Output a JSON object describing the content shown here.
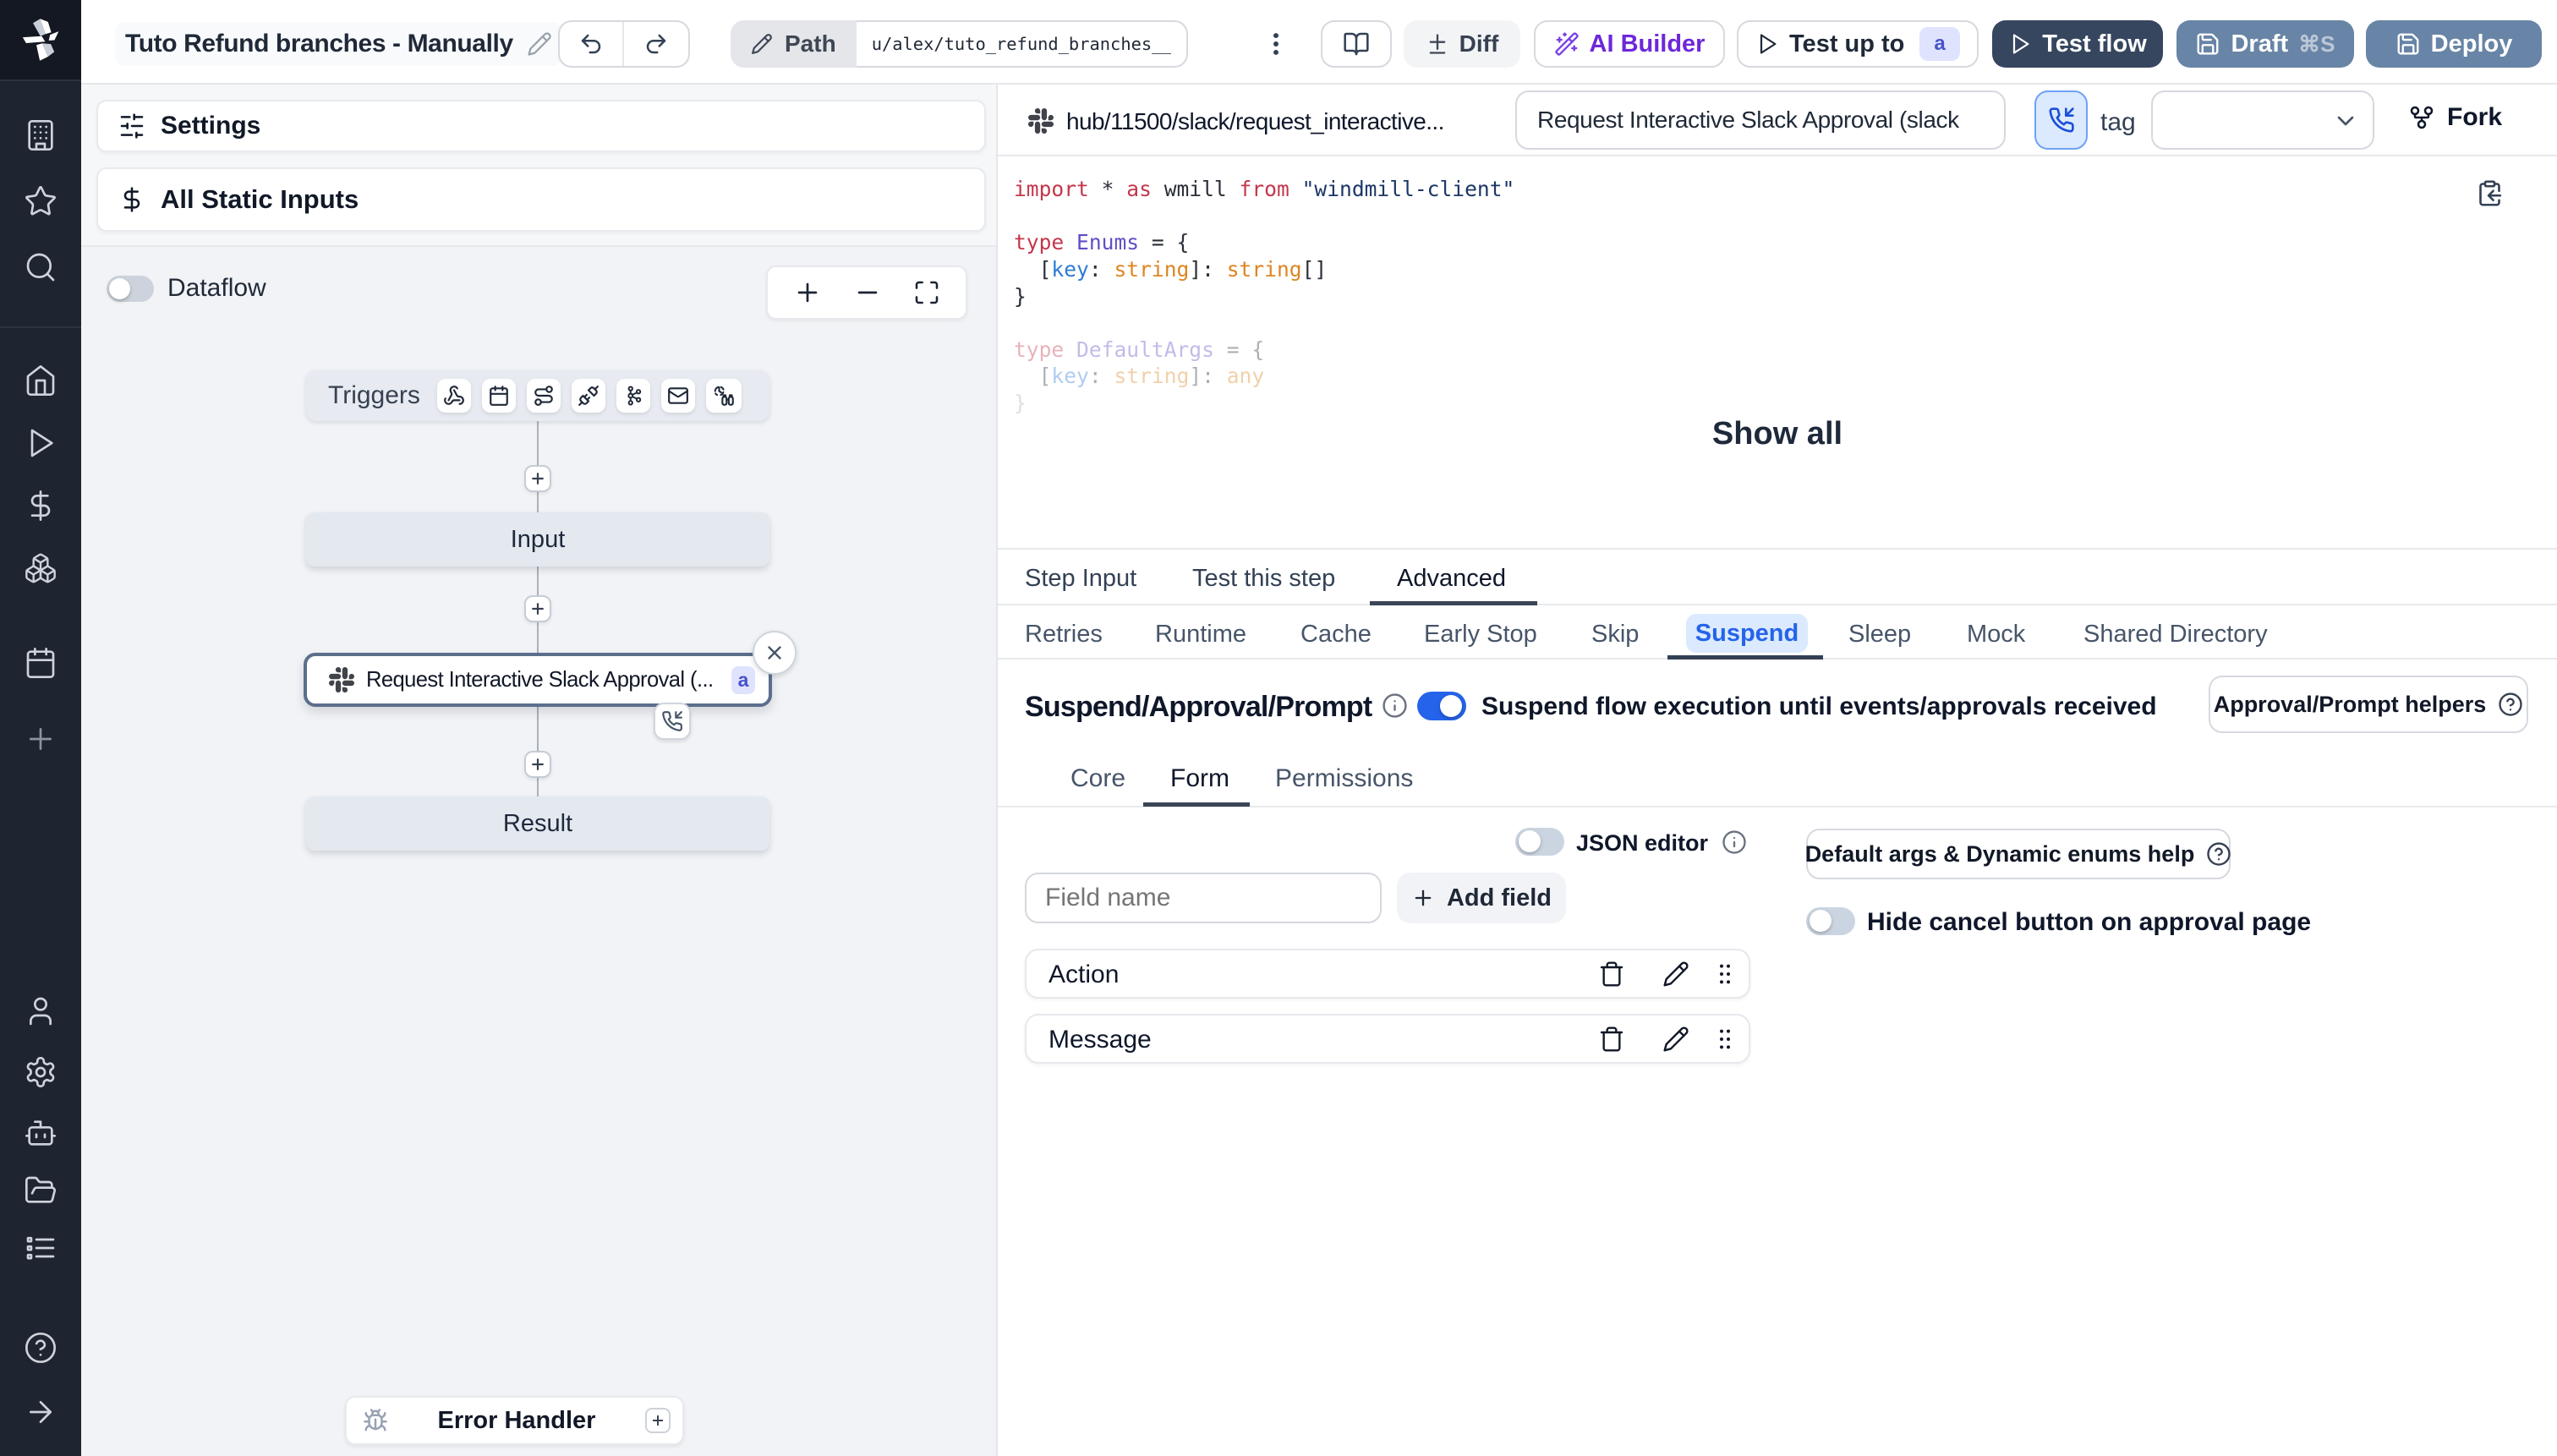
{
  "topbar": {
    "title": "Tuto Refund branches - Manually",
    "path_label": "Path",
    "path_value": "u/alex/tuto_refund_branches__",
    "diff": "Diff",
    "ai_builder": "AI Builder",
    "test_up_to": "Test up to",
    "test_up_to_badge": "a",
    "test_flow": "Test flow",
    "draft": "Draft",
    "draft_shortcut": "⌘S",
    "deploy": "Deploy"
  },
  "left": {
    "settings": "Settings",
    "static_inputs": "All Static Inputs",
    "dataflow": "Dataflow",
    "flow": {
      "triggers": "Triggers",
      "input": "Input",
      "step": "Request Interactive Slack Approval (...",
      "step_badge": "a",
      "result": "Result",
      "error_handler": "Error Handler"
    }
  },
  "step": {
    "hub_path": "hub/11500/slack/request_interactive...",
    "name": "Request Interactive Slack Approval (slack",
    "tag_label": "tag",
    "fork": "Fork",
    "show_all": "Show all",
    "code": {
      "l1": {
        "k1": "import",
        "p1": " * ",
        "k2": "as",
        "p2": " wmill ",
        "k3": "from",
        "p3": " ",
        "s1": "\"windmill-client\""
      },
      "l3": {
        "k1": "type",
        "p1": " ",
        "t1": "Enums",
        "p2": " = {"
      },
      "l4": {
        "p1": "  [",
        "v1": "key",
        "p2": ": ",
        "o1": "string",
        "p3": "]: ",
        "o2": "string",
        "p4": "[]"
      },
      "l5": {
        "p1": "}"
      },
      "l7": {
        "k1": "type",
        "p1": " ",
        "t1": "DefaultArgs",
        "p2": " = {"
      },
      "l8": {
        "p1": "  [",
        "v1": "key",
        "p2": ": ",
        "o1": "string",
        "p3": "]: ",
        "o2": "any"
      },
      "l9": {
        "p1": "}"
      }
    },
    "tabs": {
      "t1": "Step Input",
      "t2": "Test this step",
      "t3": "Advanced"
    },
    "subtabs": {
      "s1": "Retries",
      "s2": "Runtime",
      "s3": "Cache",
      "s4": "Early Stop",
      "s5": "Skip",
      "s6": "Suspend",
      "s7": "Sleep",
      "s8": "Mock",
      "s9": "Shared Directory"
    },
    "suspend": {
      "heading": "Suspend/Approval/Prompt",
      "toggle_label": "Suspend flow execution until events/approvals received",
      "helpers_button": "Approval/Prompt helpers",
      "tabs": {
        "c": "Core",
        "f": "Form",
        "p": "Permissions"
      },
      "json_editor": "JSON editor",
      "default_args_button": "Default args & Dynamic enums help",
      "field_placeholder": "Field name",
      "add_field": "Add field",
      "hide_cancel": "Hide cancel button on approval page",
      "fields": {
        "f1": "Action",
        "f2": "Message"
      }
    }
  },
  "colors": {
    "accent_blue": "#2563eb",
    "suspend_pill_bg": "#dbeafe",
    "ai_purple": "#6d28d9",
    "test_flow_bg": "#36465f",
    "deploy_bg": "#6884a6",
    "badge_bg": "#dfe3fd",
    "badge_text": "#4753c8"
  }
}
